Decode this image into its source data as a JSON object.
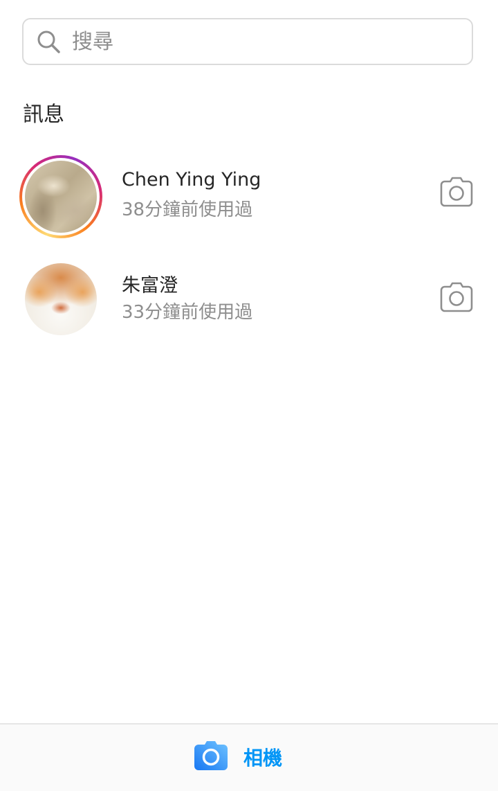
{
  "search": {
    "placeholder": "搜尋"
  },
  "section": {
    "title": "訊息"
  },
  "threads": [
    {
      "name": "Chen Ying Ying",
      "status": "38分鐘前使用過",
      "has_story": true
    },
    {
      "name": "朱富澄",
      "status": "33分鐘前使用過",
      "has_story": false
    }
  ],
  "bottom_bar": {
    "camera_label": "相機"
  },
  "colors": {
    "accent": "#0095f6",
    "muted_text": "#8e8e8e",
    "primary_text": "#262626",
    "border": "#dbdbdb"
  },
  "icons": {
    "search": "search-icon",
    "camera": "camera-icon"
  }
}
